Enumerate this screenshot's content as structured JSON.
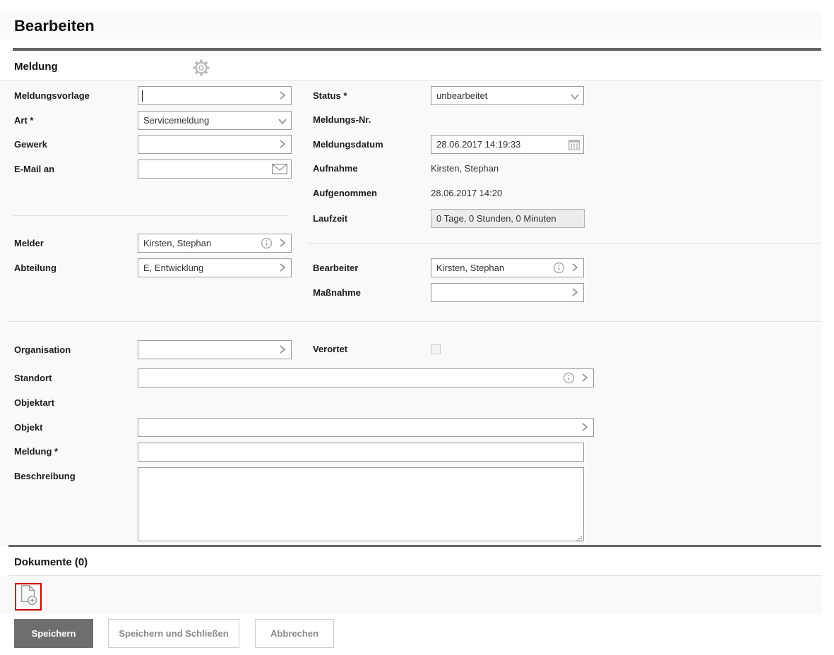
{
  "title": "Bearbeiten",
  "section_meldung": {
    "title": "Meldung"
  },
  "fields": {
    "meldungsvorlage": {
      "label": "Meldungsvorlage",
      "value": ""
    },
    "art": {
      "label": "Art *",
      "value": "Servicemeldung"
    },
    "gewerk": {
      "label": "Gewerk",
      "value": ""
    },
    "email_an": {
      "label": "E-Mail an",
      "value": ""
    },
    "status": {
      "label": "Status *",
      "value": "unbearbeitet"
    },
    "meldungs_nr": {
      "label": "Meldungs-Nr."
    },
    "meldungsdatum": {
      "label": "Meldungsdatum",
      "value": "28.06.2017 14:19:33"
    },
    "aufnahme": {
      "label": "Aufnahme",
      "value": "Kirsten, Stephan"
    },
    "aufgenommen": {
      "label": "Aufgenommen",
      "value": "28.06.2017 14:20"
    },
    "laufzeit": {
      "label": "Laufzeit",
      "value": "0 Tage, 0 Stunden, 0 Minuten"
    },
    "melder": {
      "label": "Melder",
      "value": "Kirsten, Stephan"
    },
    "abteilung": {
      "label": "Abteilung",
      "value": "E, Entwicklung"
    },
    "bearbeiter": {
      "label": "Bearbeiter",
      "value": "Kirsten, Stephan"
    },
    "massnahme": {
      "label": "Maßnahme",
      "value": ""
    },
    "organisation": {
      "label": "Organisation",
      "value": ""
    },
    "verortet": {
      "label": "Verortet",
      "checked": false
    },
    "standort": {
      "label": "Standort",
      "value": ""
    },
    "objektart": {
      "label": "Objektart"
    },
    "objekt": {
      "label": "Objekt",
      "value": ""
    },
    "meldung": {
      "label": "Meldung *",
      "value": ""
    },
    "beschreibung": {
      "label": "Beschreibung",
      "value": ""
    }
  },
  "section_dokumente": {
    "title": "Dokumente (0)"
  },
  "buttons": {
    "speichern": "Speichern",
    "speichern_und_schliessen": "Speichern und Schließen",
    "abbrechen": "Abbrechen"
  },
  "colors": {
    "accent_red": "#cc0000",
    "dark_rule": "#666666",
    "primary_button_bg": "#6e6e6e",
    "form_bg": "#f9f9f9",
    "field_border": "#9c9c9c",
    "icon_gray": "#a0a0a0",
    "readonly_bg": "#ececec"
  }
}
